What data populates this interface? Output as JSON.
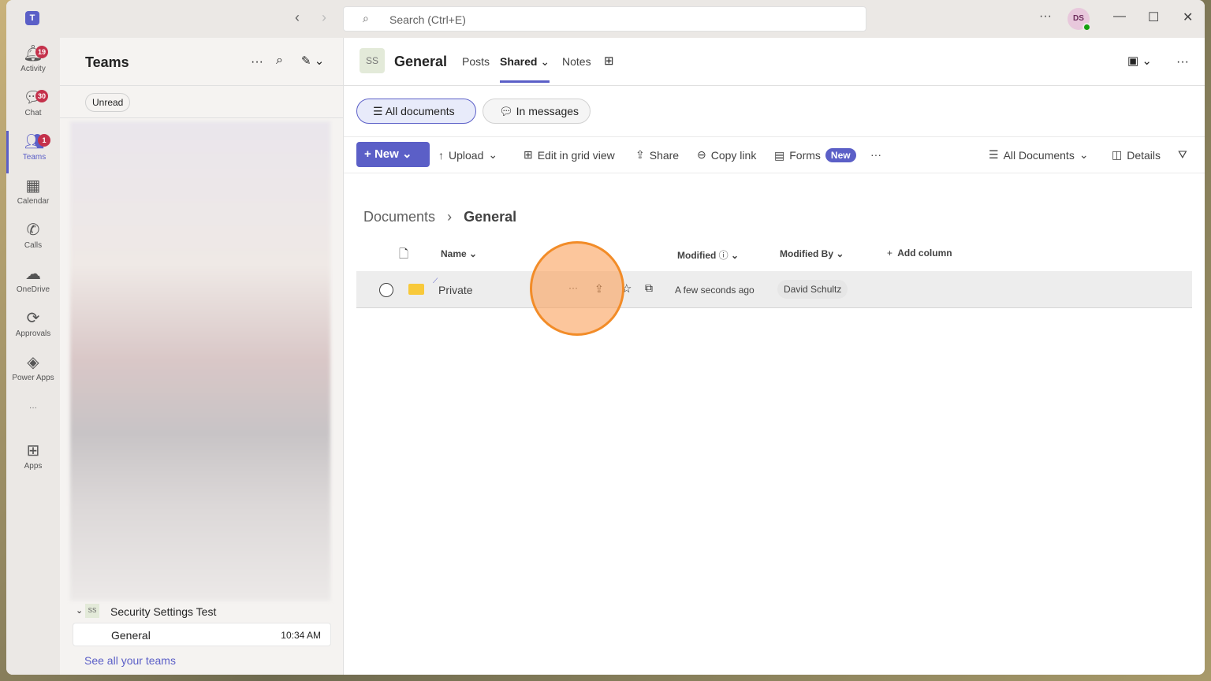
{
  "titlebar": {
    "search_placeholder": "Search (Ctrl+E)",
    "avatar": "DS"
  },
  "rail": [
    {
      "label": "Activity",
      "badge": "19",
      "icon": "bell-icon"
    },
    {
      "label": "Chat",
      "badge": "30",
      "icon": "chat-icon"
    },
    {
      "label": "Teams",
      "badge": "1",
      "icon": "teams-icon"
    },
    {
      "label": "Calendar",
      "icon": "calendar-icon"
    },
    {
      "label": "Calls",
      "icon": "phone-icon"
    },
    {
      "label": "OneDrive",
      "icon": "cloud-icon"
    },
    {
      "label": "Approvals",
      "icon": "approvals-icon"
    },
    {
      "label": "Power Apps",
      "icon": "powerapps-icon"
    },
    {
      "label": "Apps",
      "icon": "add-app-icon"
    }
  ],
  "panel": {
    "title": "Teams",
    "filter": "Unread",
    "team_initials": "SS",
    "team_name": "Security Settings Test",
    "channel": "General",
    "channel_time": "10:34 AM",
    "see_all": "See all your teams"
  },
  "header": {
    "initials": "SS",
    "channel": "General",
    "tabs": [
      "Posts",
      "Shared",
      "Notes"
    ]
  },
  "views": {
    "all": "All documents",
    "messages": "In messages"
  },
  "toolbar": {
    "new": "New",
    "upload": "Upload",
    "grid": "Edit in grid view",
    "share": "Share",
    "copy": "Copy link",
    "forms": "Forms",
    "forms_badge": "New",
    "view": "All Documents",
    "details": "Details"
  },
  "breadcrumb": {
    "root": "Documents",
    "current": "General"
  },
  "columns": {
    "name": "Name",
    "modified": "Modified",
    "modified_by": "Modified By",
    "add": "Add column"
  },
  "rows": [
    {
      "name": "Private",
      "modified": "A few seconds ago",
      "modified_by": "David Schultz"
    }
  ]
}
